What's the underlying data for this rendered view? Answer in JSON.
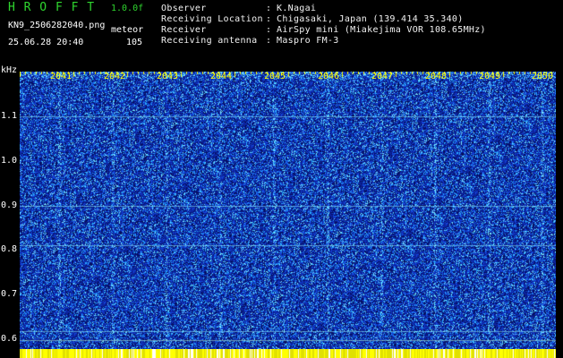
{
  "header": {
    "logo": "H R O F F T",
    "version": "1.0.0f",
    "filename": "KN9_2506282040.png",
    "mode": "meteor",
    "datetime": "25.06.28 20:40",
    "count": "105"
  },
  "info": [
    {
      "label": "Observer",
      "value": "K.Nagai"
    },
    {
      "label": "Receiving Location",
      "value": "Chigasaki, Japan (139.414 35.340)"
    },
    {
      "label": "Receiver",
      "value": "AirSpy mini (Miakejima VOR 108.65MHz)"
    },
    {
      "label": "Receiving antenna",
      "value": "Maspro FM-3"
    }
  ],
  "colon": ":",
  "y_axis": {
    "unit": "kHz",
    "labels": [
      "1.1",
      "1.0",
      "0.9",
      "0.8",
      "0.7",
      "0.6"
    ]
  },
  "x_axis": {
    "labels": [
      "2041",
      "2042",
      "2043",
      "2044",
      "2045",
      "2046",
      "2047",
      "2048",
      "2049",
      "2050"
    ]
  },
  "colors": {
    "background": "#000000",
    "noise_dark": "#0a1e8c",
    "noise_light": "#3cc8ff",
    "tick": "#ffff00",
    "logo": "#2fd62f"
  }
}
